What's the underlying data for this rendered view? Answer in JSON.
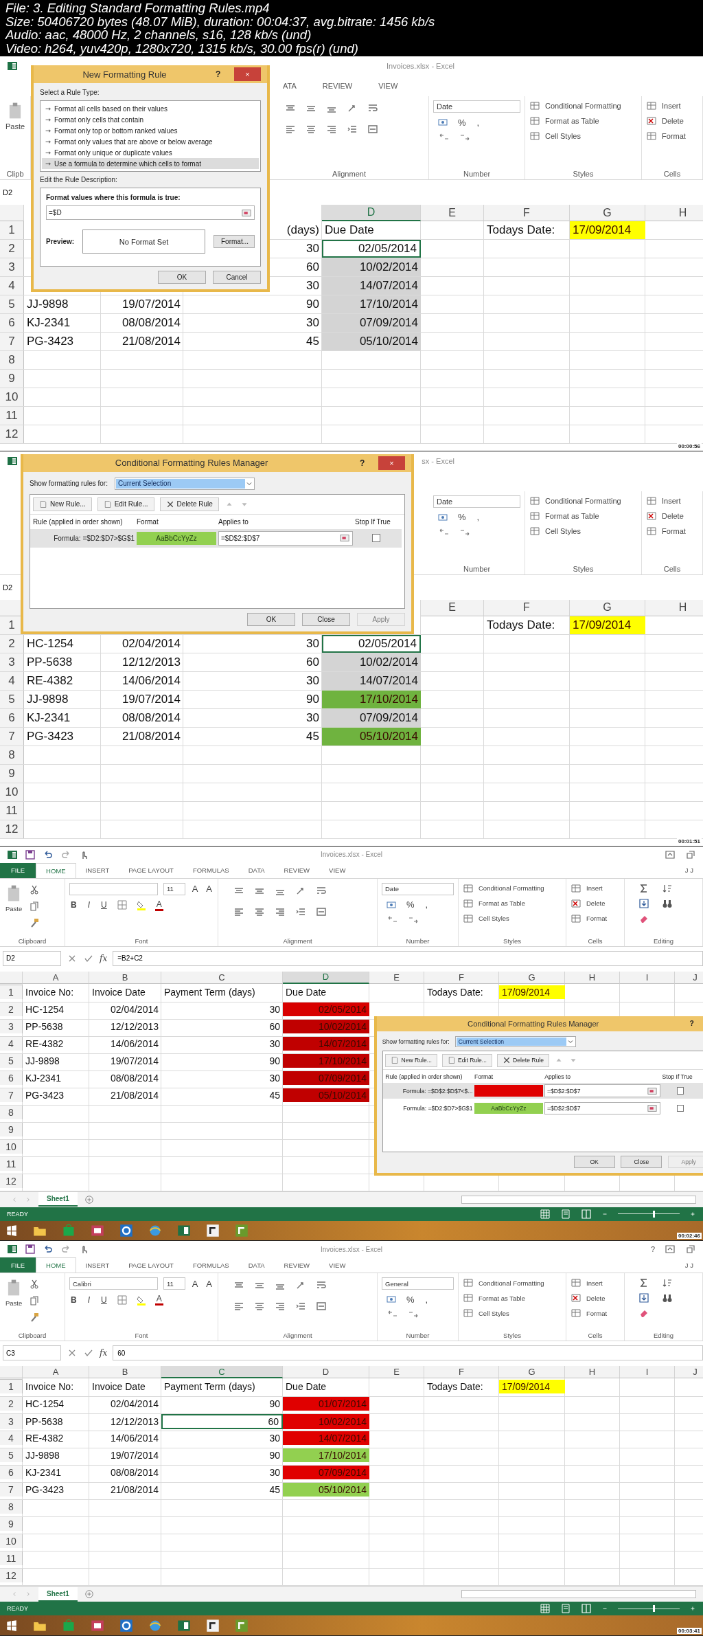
{
  "file_info": [
    "File: 3. Editing Standard Formatting Rules.mp4",
    "Size: 50406720 bytes (48.07 MiB), duration: 00:04:37, avg.bitrate: 1456 kb/s",
    "Audio: aac, 48000 Hz, 2 channels, s16, 128 kb/s (und)",
    "Video: h264, yuv420p, 1280x720, 1315 kb/s, 30.00 fps(r) (und)"
  ],
  "frames": [
    {
      "kind": "zoomed",
      "title_bar": {
        "title": "Invoices.xlsx - Excel"
      },
      "tabs": [
        {
          "label": "ATA",
          "kind": "tab",
          "selected": false
        },
        {
          "label": "REVIEW",
          "kind": "tab",
          "selected": false
        },
        {
          "label": "VIEW",
          "kind": "tab",
          "selected": false
        }
      ],
      "ribbon": [
        {
          "kind": "clipboard",
          "paste": "Paste",
          "label": "Clipb"
        },
        {
          "kind": "alignment",
          "label": "Alignment"
        },
        {
          "kind": "number",
          "format": "Date",
          "symbols": [
            "%",
            ","
          ],
          "label": "Number"
        },
        {
          "kind": "styles",
          "items": [
            "Conditional Formatting",
            "Format as Table",
            "Cell Styles"
          ],
          "label": "Styles"
        },
        {
          "kind": "cells",
          "items": [
            "Insert",
            "Delete",
            "Format"
          ],
          "label": "Cells"
        }
      ],
      "formula_bar": {
        "name_box": "D2"
      },
      "columns": [
        null,
        null,
        null,
        {
          "label": "D",
          "selected": true
        },
        {
          "label": "E",
          "selected": false
        },
        {
          "label": "F",
          "selected": false
        },
        {
          "label": "G",
          "selected": false
        },
        {
          "label": "H",
          "selected": false
        }
      ],
      "rows": [
        {
          "label": "1",
          "kind": "labels",
          "cells": [
            null,
            null,
            {
              "text": "(days)",
              "kind": "clipped"
            },
            "Due Date",
            null,
            "Todays Date:",
            {
              "text": "17/09/2014",
              "color": "#ffff00"
            }
          ]
        },
        {
          "label": "2",
          "kind": "values",
          "cells": [
            null,
            null,
            "30",
            {
              "text": "02/05/2014",
              "kind": "active"
            }
          ]
        },
        {
          "label": "3",
          "kind": "values",
          "cells": [
            null,
            null,
            "60",
            {
              "text": "10/02/2014",
              "kind": "in_selection"
            }
          ]
        },
        {
          "label": "4",
          "kind": "values",
          "cells": [
            null,
            null,
            "30",
            {
              "text": "14/07/2014",
              "kind": "in_selection"
            }
          ]
        },
        {
          "label": "5",
          "kind": "values",
          "cells": [
            "JJ-9898",
            "19/07/2014",
            "90",
            {
              "text": "17/10/2014",
              "kind": "in_selection"
            }
          ]
        },
        {
          "label": "6",
          "kind": "values",
          "cells": [
            "KJ-2341",
            "08/08/2014",
            "30",
            {
              "text": "07/09/2014",
              "kind": "in_selection"
            }
          ]
        },
        {
          "label": "7",
          "kind": "values",
          "cells": [
            "PG-3423",
            "21/08/2014",
            "45",
            {
              "text": "05/10/2014",
              "kind": "in_selection"
            }
          ]
        },
        {
          "label": "8"
        },
        {
          "label": "9"
        },
        {
          "label": "10"
        },
        {
          "label": "11"
        },
        {
          "label": "12"
        }
      ],
      "dialog": {
        "kind": "new_rule",
        "title": "New Formatting Rule",
        "help": "?",
        "close": "×",
        "type_heading": "Select a Rule Type:",
        "rule_types": [
          {
            "label": "Format all cells based on their values",
            "selected": false
          },
          {
            "label": "Format only cells that contain",
            "selected": false
          },
          {
            "label": "Format only top or bottom ranked values",
            "selected": false
          },
          {
            "label": "Format only values that are above or below average",
            "selected": false
          },
          {
            "label": "Format only unique or duplicate values",
            "selected": false
          },
          {
            "label": "Use a formula to determine which cells to format",
            "selected": true
          }
        ],
        "description_heading": "Edit the Rule Description:",
        "formula_label": "Format values where this formula is true:",
        "formula": "=$D",
        "preview_label": "Preview:",
        "preview": "No Format Set",
        "format_button": "Format...",
        "buttons": [
          {
            "label": "OK",
            "disabled": false
          },
          {
            "label": "Cancel",
            "disabled": false
          }
        ]
      },
      "timestamp": "00:00:56"
    },
    {
      "kind": "zoomed",
      "title_bar": {
        "title": "sx - Excel"
      },
      "ribbon": [
        {
          "kind": "number",
          "format": "Date",
          "symbols": [
            "%",
            ","
          ],
          "label": "Number"
        },
        {
          "kind": "styles",
          "items": [
            "Conditional Formatting",
            "Format as Table",
            "Cell Styles"
          ],
          "label": "Styles"
        },
        {
          "kind": "cells",
          "items": [
            "Insert",
            "Delete",
            "Format"
          ],
          "label": "Cells"
        }
      ],
      "formula_bar": {
        "name_box": "D2"
      },
      "columns": [
        null,
        null,
        null,
        null,
        {
          "label": "E",
          "selected": false
        },
        {
          "label": "F",
          "selected": false
        },
        {
          "label": "G",
          "selected": false
        },
        {
          "label": "H",
          "selected": false
        }
      ],
      "rows": [
        {
          "label": "1",
          "kind": "labels",
          "cells": [
            null,
            null,
            null,
            null,
            null,
            "Todays Date:",
            {
              "text": "17/09/2014",
              "color": "#ffff00"
            }
          ]
        },
        {
          "label": "2",
          "kind": "values",
          "cells": [
            "HC-1254",
            "02/04/2014",
            "30",
            {
              "text": "02/05/2014",
              "kind": "active"
            }
          ]
        },
        {
          "label": "3",
          "kind": "values",
          "cells": [
            "PP-5638",
            "12/12/2013",
            "60",
            {
              "text": "10/02/2014",
              "kind": "in_selection"
            }
          ]
        },
        {
          "label": "4",
          "kind": "values",
          "cells": [
            "RE-4382",
            "14/06/2014",
            "30",
            {
              "text": "14/07/2014",
              "kind": "in_selection"
            }
          ]
        },
        {
          "label": "5",
          "kind": "values",
          "cells": [
            "JJ-9898",
            "19/07/2014",
            "90",
            {
              "text": "17/10/2014",
              "color": "#6fb33f"
            }
          ]
        },
        {
          "label": "6",
          "kind": "values",
          "cells": [
            "KJ-2341",
            "08/08/2014",
            "30",
            {
              "text": "07/09/2014",
              "kind": "in_selection"
            }
          ]
        },
        {
          "label": "7",
          "kind": "values",
          "cells": [
            "PG-3423",
            "21/08/2014",
            "45",
            {
              "text": "05/10/2014",
              "color": "#6fb33f"
            }
          ]
        },
        {
          "label": "8"
        },
        {
          "label": "9"
        },
        {
          "label": "10"
        },
        {
          "label": "11"
        },
        {
          "label": "12"
        }
      ],
      "dialog": {
        "kind": "rules_manager",
        "title": "Conditional Formatting Rules Manager",
        "help": "?",
        "close": "×",
        "show_label": "Show formatting rules for:",
        "scope": "Current Selection",
        "actions": [
          "New Rule...",
          "Edit Rule...",
          "Delete Rule"
        ],
        "columns": [
          "Rule (applied in order shown)",
          "Format",
          "Applies to",
          "Stop If True"
        ],
        "rules": [
          {
            "rule": "Formula: =$D2:$D7>$G$1",
            "color": "#92d050",
            "sample": "AaBbCcYyZz",
            "applies_to": "=$D$2:$D$7",
            "stop_if_true": false,
            "selected": true
          }
        ],
        "buttons": [
          {
            "label": "OK",
            "disabled": false
          },
          {
            "label": "Close",
            "disabled": false
          },
          {
            "label": "Apply",
            "disabled": true
          }
        ]
      },
      "timestamp": "00:01:51"
    },
    {
      "kind": "normal",
      "title_bar": {
        "title": "Invoices.xlsx - Excel"
      },
      "tabs": [
        {
          "label": "FILE",
          "kind": "file",
          "selected": false
        },
        {
          "label": "HOME",
          "kind": "tab",
          "selected": true
        },
        {
          "label": "INSERT",
          "kind": "tab",
          "selected": false
        },
        {
          "label": "PAGE LAYOUT",
          "kind": "tab",
          "selected": false
        },
        {
          "label": "FORMULAS",
          "kind": "tab",
          "selected": false
        },
        {
          "label": "DATA",
          "kind": "tab",
          "selected": false
        },
        {
          "label": "REVIEW",
          "kind": "tab",
          "selected": false
        },
        {
          "label": "VIEW",
          "kind": "tab",
          "selected": false
        }
      ],
      "user": "J J",
      "ribbon": [
        {
          "kind": "clipboard",
          "paste": "Paste",
          "label": "Clipboard"
        },
        {
          "kind": "font",
          "size": "11",
          "size_buttons": [
            "A",
            "A"
          ],
          "style_buttons": [
            "B",
            "I",
            "U"
          ],
          "color_button": "A",
          "label": "Font"
        },
        {
          "kind": "alignment",
          "label": "Alignment"
        },
        {
          "kind": "number",
          "format": "Date",
          "symbols": [
            "%",
            ","
          ],
          "label": "Number"
        },
        {
          "kind": "styles",
          "items": [
            "Conditional Formatting",
            "Format as Table",
            "Cell Styles"
          ],
          "label": "Styles"
        },
        {
          "kind": "cells",
          "items": [
            "Insert",
            "Delete",
            "Format"
          ],
          "label": "Cells"
        },
        {
          "kind": "editing",
          "label": "Editing"
        }
      ],
      "formula_bar": {
        "name_box": "D2",
        "fx": "fx",
        "formula": "=B2+C2"
      },
      "columns": [
        {
          "label": "A",
          "selected": false
        },
        {
          "label": "B",
          "selected": false
        },
        {
          "label": "C",
          "selected": false
        },
        {
          "label": "D",
          "selected": true
        },
        {
          "label": "E",
          "selected": false
        },
        {
          "label": "F",
          "selected": false
        },
        {
          "label": "G",
          "selected": false
        },
        {
          "label": "H",
          "selected": false
        },
        {
          "label": "I",
          "selected": false
        },
        {
          "label": "J",
          "selected": false
        }
      ],
      "rows": [
        {
          "label": "1",
          "kind": "labels",
          "cells": [
            "Invoice No:",
            "Invoice Date",
            "Payment Term (days)",
            "Due Date",
            null,
            "Todays Date:",
            {
              "text": "17/09/2014",
              "color": "#ffff00"
            }
          ]
        },
        {
          "label": "2",
          "kind": "values",
          "cells": [
            "HC-1254",
            "02/04/2014",
            "30",
            {
              "text": "02/05/2014",
              "color": "#d80000"
            }
          ]
        },
        {
          "label": "3",
          "kind": "values",
          "cells": [
            "PP-5638",
            "12/12/2013",
            "60",
            {
              "text": "10/02/2014",
              "color": "#c00000"
            }
          ]
        },
        {
          "label": "4",
          "kind": "values",
          "cells": [
            "RE-4382",
            "14/06/2014",
            "30",
            {
              "text": "14/07/2014",
              "color": "#c00000"
            }
          ]
        },
        {
          "label": "5",
          "kind": "values",
          "cells": [
            "JJ-9898",
            "19/07/2014",
            "90",
            {
              "text": "17/10/2014",
              "color": "#c00000"
            }
          ]
        },
        {
          "label": "6",
          "kind": "values",
          "cells": [
            "KJ-2341",
            "08/08/2014",
            "30",
            {
              "text": "07/09/2014",
              "color": "#c00000"
            }
          ]
        },
        {
          "label": "7",
          "kind": "values",
          "cells": [
            "PG-3423",
            "21/08/2014",
            "45",
            {
              "text": "05/10/2014",
              "color": "#c00000"
            }
          ]
        },
        {
          "label": "8"
        },
        {
          "label": "9"
        },
        {
          "label": "10"
        },
        {
          "label": "11"
        },
        {
          "label": "12"
        }
      ],
      "sheet_tabs": [
        {
          "label": "Sheet1",
          "selected": true
        }
      ],
      "status_bar": {
        "text": "READY",
        "zoom": {
          "level": 0.58
        }
      },
      "dialog": {
        "kind": "rules_manager",
        "title": "Conditional Formatting Rules Manager",
        "help": "?",
        "show_label": "Show formatting rules for:",
        "scope": "Current Selection",
        "actions": [
          "New Rule...",
          "Edit Rule...",
          "Delete Rule"
        ],
        "columns": [
          "Rule (applied in order shown)",
          "Format",
          "Applies to",
          "Stop If True"
        ],
        "rules": [
          {
            "rule": "Formula: =$D$2:$D$7<$...",
            "color": "#e00000",
            "applies_to": "=$D$2:$D$7",
            "stop_if_true": false,
            "selected": true
          },
          {
            "rule": "Formula: =$D2:$D7>$G$1",
            "color": "#92d050",
            "sample": "AaBbCcYyZz",
            "applies_to": "=$D$2:$D$7",
            "stop_if_true": false,
            "selected": false
          }
        ],
        "buttons": [
          {
            "label": "OK",
            "disabled": false
          },
          {
            "label": "Close",
            "disabled": false
          },
          {
            "label": "Apply",
            "disabled": true
          }
        ]
      },
      "timestamp": "00:02:46"
    },
    {
      "kind": "normal",
      "title_bar": {
        "title": "Invoices.xlsx - Excel",
        "help": "?"
      },
      "tabs": [
        {
          "label": "FILE",
          "kind": "file",
          "selected": false
        },
        {
          "label": "HOME",
          "kind": "tab",
          "selected": true
        },
        {
          "label": "INSERT",
          "kind": "tab",
          "selected": false
        },
        {
          "label": "PAGE LAYOUT",
          "kind": "tab",
          "selected": false
        },
        {
          "label": "FORMULAS",
          "kind": "tab",
          "selected": false
        },
        {
          "label": "DATA",
          "kind": "tab",
          "selected": false
        },
        {
          "label": "REVIEW",
          "kind": "tab",
          "selected": false
        },
        {
          "label": "VIEW",
          "kind": "tab",
          "selected": false
        }
      ],
      "user": "J J",
      "ribbon": [
        {
          "kind": "clipboard",
          "paste": "Paste",
          "label": "Clipboard"
        },
        {
          "kind": "font",
          "font": "Calibri",
          "size": "11",
          "size_buttons": [
            "A",
            "A"
          ],
          "style_buttons": [
            "B",
            "I",
            "U"
          ],
          "color_button": "A",
          "label": "Font"
        },
        {
          "kind": "alignment",
          "label": "Alignment"
        },
        {
          "kind": "number",
          "format": "General",
          "symbols": [
            "%",
            ","
          ],
          "label": "Number"
        },
        {
          "kind": "styles",
          "items": [
            "Conditional Formatting",
            "Format as Table",
            "Cell Styles"
          ],
          "label": "Styles"
        },
        {
          "kind": "cells",
          "items": [
            "Insert",
            "Delete",
            "Format"
          ],
          "label": "Cells"
        },
        {
          "kind": "editing",
          "label": "Editing"
        }
      ],
      "formula_bar": {
        "name_box": "C3",
        "fx": "fx",
        "formula": "60"
      },
      "columns": [
        {
          "label": "A",
          "selected": false
        },
        {
          "label": "B",
          "selected": false
        },
        {
          "label": "C",
          "selected": true
        },
        {
          "label": "D",
          "selected": false
        },
        {
          "label": "E",
          "selected": false
        },
        {
          "label": "F",
          "selected": false
        },
        {
          "label": "G",
          "selected": false
        },
        {
          "label": "H",
          "selected": false
        },
        {
          "label": "I",
          "selected": false
        },
        {
          "label": "J",
          "selected": false
        }
      ],
      "rows": [
        {
          "label": "1",
          "kind": "labels",
          "cells": [
            "Invoice No:",
            "Invoice Date",
            "Payment Term (days)",
            "Due Date",
            null,
            "Todays Date:",
            {
              "text": "17/09/2014",
              "color": "#ffff00"
            }
          ]
        },
        {
          "label": "2",
          "kind": "values",
          "cells": [
            "HC-1254",
            "02/04/2014",
            "90",
            {
              "text": "01/07/2014",
              "color": "#e00000"
            }
          ]
        },
        {
          "label": "3",
          "kind": "values",
          "cells": [
            "PP-5638",
            "12/12/2013",
            {
              "text": "60",
              "kind": "active"
            },
            {
              "text": "10/02/2014",
              "color": "#e00000"
            }
          ]
        },
        {
          "label": "4",
          "kind": "values",
          "cells": [
            "RE-4382",
            "14/06/2014",
            "30",
            {
              "text": "14/07/2014",
              "color": "#e00000"
            }
          ]
        },
        {
          "label": "5",
          "kind": "values",
          "cells": [
            "JJ-9898",
            "19/07/2014",
            "90",
            {
              "text": "17/10/2014",
              "color": "#92d050"
            }
          ]
        },
        {
          "label": "6",
          "kind": "values",
          "cells": [
            "KJ-2341",
            "08/08/2014",
            "30",
            {
              "text": "07/09/2014",
              "color": "#e00000"
            }
          ]
        },
        {
          "label": "7",
          "kind": "values",
          "cells": [
            "PG-3423",
            "21/08/2014",
            "45",
            {
              "text": "05/10/2014",
              "color": "#92d050"
            }
          ]
        },
        {
          "label": "8"
        },
        {
          "label": "9"
        },
        {
          "label": "10"
        },
        {
          "label": "11"
        },
        {
          "label": "12"
        }
      ],
      "sheet_tabs": [
        {
          "label": "Sheet1",
          "selected": true
        }
      ],
      "status_bar": {
        "text": "READY",
        "zoom": {
          "level": 0.58
        }
      },
      "timestamp": "00:03:41"
    }
  ]
}
